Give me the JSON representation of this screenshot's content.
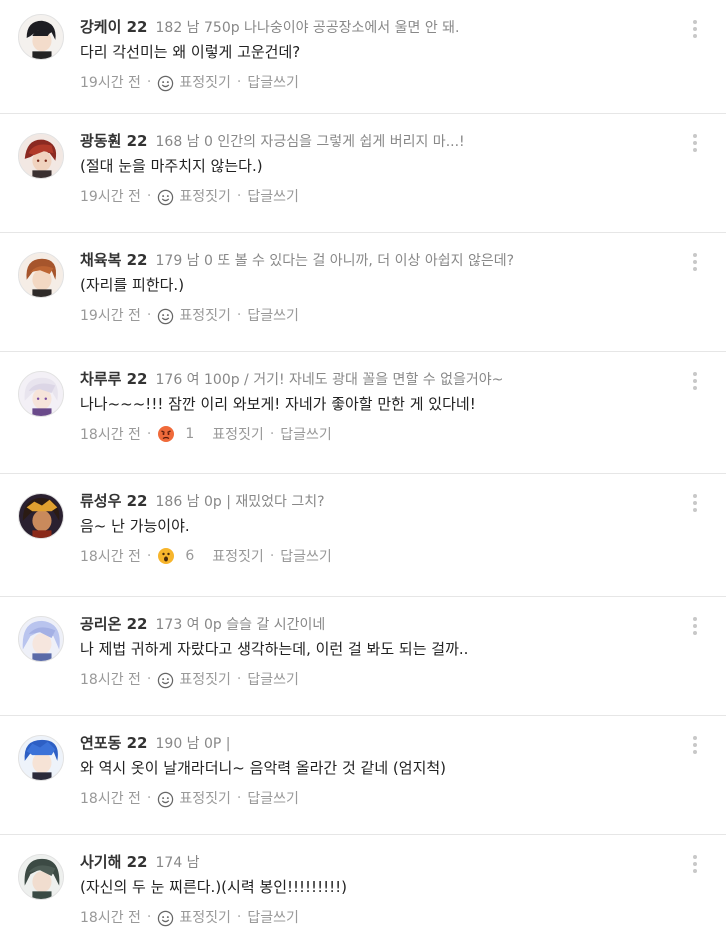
{
  "comments": [
    {
      "name": "강케이 22",
      "meta": "182 남 750p 나나숭이야 공공장소에서 울면 안 돼.",
      "text": "다리 각선미는 왜 이렇게 고운건데?",
      "time": "19시간 전",
      "react_label": "표정짓기",
      "reply_label": "답글쓰기",
      "avatar": "avatar-1"
    },
    {
      "name": "광동훤 22",
      "meta": "168 남 0 인간의 자긍심을 그렇게 쉽게 버리지 마...!",
      "text": "(절대 눈을 마주치지 않는다.)",
      "time": "19시간 전",
      "react_label": "표정짓기",
      "reply_label": "답글쓰기",
      "avatar": "avatar-2"
    },
    {
      "name": "채육복 22",
      "meta": "179 남 0 또 볼 수 있다는 걸 아니까, 더 이상 아쉽지 않은데?",
      "text": "(자리를 피한다.)",
      "time": "19시간 전",
      "react_label": "표정짓기",
      "reply_label": "답글쓰기",
      "avatar": "avatar-3"
    },
    {
      "name": "차루루 22",
      "meta": "176 여 100p / 거기! 자네도 광대 꼴을 면할 수 없을거야~",
      "text": "나나~~~!!! 잠깐 이리 와보게! 자네가 좋아할 만한 게 있다네!",
      "time": "18시간 전",
      "reaction_icon": "angry-face-icon",
      "reaction_count": "1",
      "react_label": "표정짓기",
      "reply_label": "답글쓰기",
      "avatar": "avatar-4"
    },
    {
      "name": "류성우 22",
      "meta": "186 남 0p | 재밌었다 그치?",
      "text": "음~ 난 가능이야.",
      "time": "18시간 전",
      "reaction_icon": "surprised-face-icon",
      "reaction_count": "6",
      "react_label": "표정짓기",
      "reply_label": "답글쓰기",
      "avatar": "avatar-5"
    },
    {
      "name": "공리온 22",
      "meta": "173 여 0p 슬슬 갈 시간이네",
      "text": "나 제법 귀하게 자랐다고 생각하는데, 이런 걸 봐도 되는 걸까..",
      "time": "18시간 전",
      "react_label": "표정짓기",
      "reply_label": "답글쓰기",
      "avatar": "avatar-6"
    },
    {
      "name": "연포동 22",
      "meta": "190 남 0P |",
      "text": "와 역시 옷이 날개라더니~ 음악력 올라간 것 같네 (엄지척)",
      "time": "18시간 전",
      "react_label": "표정짓기",
      "reply_label": "답글쓰기",
      "avatar": "avatar-7"
    },
    {
      "name": "사기해 22",
      "meta": "174 남",
      "text": "(자신의 두 눈 찌른다.)(시력 봉인!!!!!!!!!)",
      "time": "18시간 전",
      "react_label": "표정짓기",
      "reply_label": "답글쓰기",
      "avatar": "avatar-8"
    }
  ],
  "colors": {
    "name": "#333333",
    "meta": "#888888",
    "divider": "#e6e6e6",
    "angry": "#f06a3a",
    "surprised": "#f7b52c"
  }
}
